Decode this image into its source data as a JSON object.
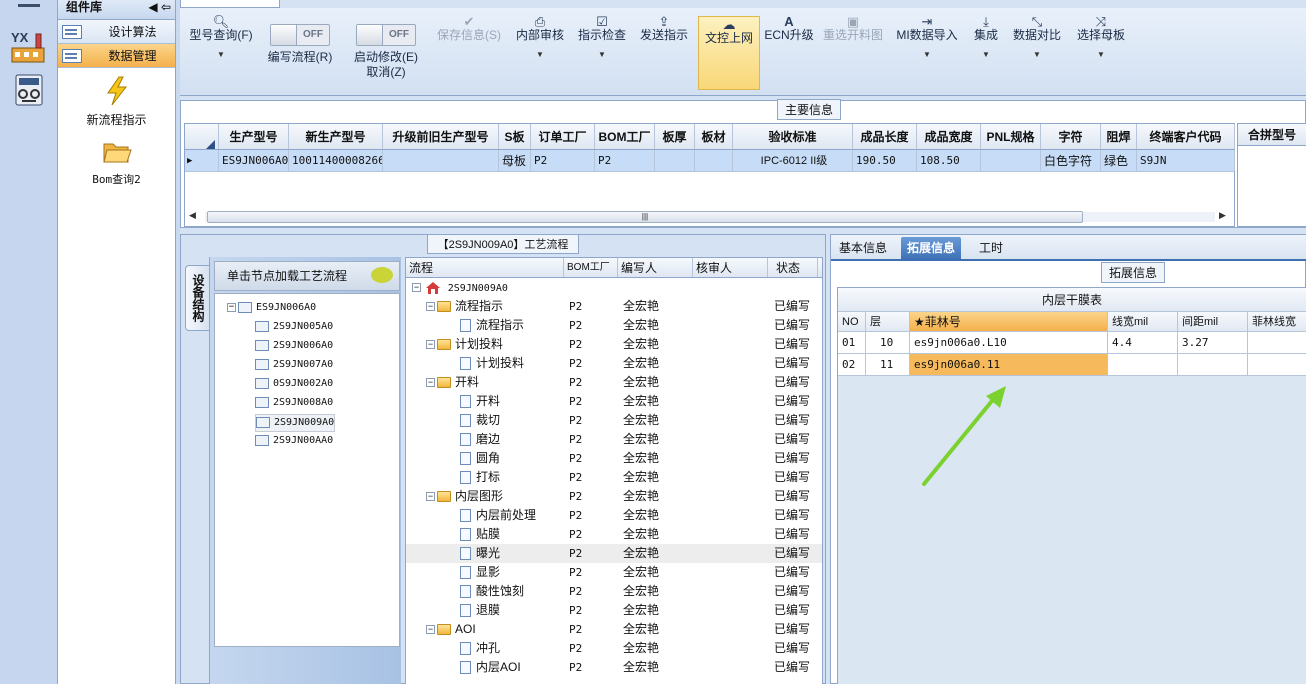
{
  "library": {
    "title": "组件库",
    "categories": [
      {
        "label": "设计算法",
        "active": false
      },
      {
        "label": "数据管理",
        "active": true
      }
    ],
    "tools": [
      {
        "label": "新流程指示",
        "icon": "lightning-icon"
      },
      {
        "label": "Bom查询2",
        "icon": "folder-open-icon"
      }
    ]
  },
  "rail": {
    "app_logo_text": "YX"
  },
  "ribbon": {
    "buttons": [
      {
        "label": "型号查询(F)",
        "icon": "search-icon",
        "dropdown": true
      },
      {
        "label": "编写流程(R)",
        "toggle": "OFF"
      },
      {
        "label": "启动修改(E)",
        "sublabel": "取消(Z)",
        "toggle": "OFF"
      },
      {
        "label": "保存信息(S)",
        "icon": "check-icon",
        "disabled": true
      },
      {
        "label": "内部审核",
        "icon": "print-icon",
        "dropdown": true
      },
      {
        "label": "指示检查",
        "icon": "checkbox-icon",
        "dropdown": true
      },
      {
        "label": "发送指示",
        "icon": "upload-icon"
      },
      {
        "label": "文控上网",
        "icon": "cloud-upload-icon",
        "highlighted": true
      },
      {
        "label": "ECN升级",
        "icon": "font-icon"
      },
      {
        "label": "重选开料图",
        "icon": "image-icon",
        "disabled": true
      },
      {
        "label": "MI数据导入",
        "icon": "sign-in-icon",
        "dropdown": true
      },
      {
        "label": "集成",
        "icon": "download-icon",
        "dropdown": true
      },
      {
        "label": "数据对比",
        "icon": "compress-icon",
        "dropdown": true
      },
      {
        "label": "选择母板",
        "icon": "random-icon",
        "dropdown": true
      }
    ]
  },
  "main_info": {
    "title": "主要信息",
    "columns": [
      "生产型号",
      "新生产型号",
      "升级前旧生产型号",
      "S板",
      "订单工厂",
      "BOM工厂",
      "板厚",
      "板材",
      "验收标准",
      "成品长度",
      "成品宽度",
      "PNL规格",
      "字符",
      "阻焊",
      "终端客户代码"
    ],
    "row": [
      "ES9JN006A0",
      "10011400008266",
      "",
      "母板",
      "P2",
      "P2",
      "",
      "",
      "IPC-6012 II级",
      "190.50",
      "108.50",
      "",
      "白色字符",
      "绿色",
      "S9JN"
    ],
    "side_header": "合拼型号"
  },
  "flow": {
    "title": "【2S9JN009A0】工艺流程",
    "vertical_tab": "设备结构",
    "tree_header": "单击节点加载工艺流程",
    "tree_root": "ES9JN006A0",
    "tree_children": [
      "2S9JN005A0",
      "2S9JN006A0",
      "2S9JN007A0",
      "0S9JN002A0",
      "2S9JN008A0",
      "2S9JN009A0",
      "2S9JN00AA0"
    ],
    "tree_selected_index": 5,
    "grid_headers": [
      "流程",
      "BOM工厂",
      "编写人",
      "核审人",
      "状态"
    ],
    "grid_root": "2S9JN009A0",
    "rows": [
      {
        "name": "流程指示",
        "level": 1,
        "type": "folder",
        "bom": "P2",
        "writer": "全宏艳",
        "status": "已编写"
      },
      {
        "name": "流程指示",
        "level": 2,
        "type": "doc",
        "bom": "P2",
        "writer": "全宏艳",
        "status": "已编写"
      },
      {
        "name": "计划投料",
        "level": 1,
        "type": "folder",
        "bom": "P2",
        "writer": "全宏艳",
        "status": "已编写"
      },
      {
        "name": "计划投料",
        "level": 2,
        "type": "doc",
        "bom": "P2",
        "writer": "全宏艳",
        "status": "已编写"
      },
      {
        "name": "开料",
        "level": 1,
        "type": "folder",
        "bom": "P2",
        "writer": "全宏艳",
        "status": "已编写"
      },
      {
        "name": "开料",
        "level": 2,
        "type": "doc",
        "bom": "P2",
        "writer": "全宏艳",
        "status": "已编写"
      },
      {
        "name": "裁切",
        "level": 2,
        "type": "doc",
        "bom": "P2",
        "writer": "全宏艳",
        "status": "已编写"
      },
      {
        "name": "磨边",
        "level": 2,
        "type": "doc",
        "bom": "P2",
        "writer": "全宏艳",
        "status": "已编写"
      },
      {
        "name": "圆角",
        "level": 2,
        "type": "doc",
        "bom": "P2",
        "writer": "全宏艳",
        "status": "已编写"
      },
      {
        "name": "打标",
        "level": 2,
        "type": "doc",
        "bom": "P2",
        "writer": "全宏艳",
        "status": "已编写"
      },
      {
        "name": "内层图形",
        "level": 1,
        "type": "folder",
        "bom": "P2",
        "writer": "全宏艳",
        "status": "已编写"
      },
      {
        "name": "内层前处理",
        "level": 2,
        "type": "doc",
        "bom": "P2",
        "writer": "全宏艳",
        "status": "已编写"
      },
      {
        "name": "贴膜",
        "level": 2,
        "type": "doc",
        "bom": "P2",
        "writer": "全宏艳",
        "status": "已编写"
      },
      {
        "name": "曝光",
        "level": 2,
        "type": "doc",
        "bom": "P2",
        "writer": "全宏艳",
        "status": "已编写",
        "selected": true
      },
      {
        "name": "显影",
        "level": 2,
        "type": "doc",
        "bom": "P2",
        "writer": "全宏艳",
        "status": "已编写"
      },
      {
        "name": "酸性蚀刻",
        "level": 2,
        "type": "doc",
        "bom": "P2",
        "writer": "全宏艳",
        "status": "已编写"
      },
      {
        "name": "退膜",
        "level": 2,
        "type": "doc",
        "bom": "P2",
        "writer": "全宏艳",
        "status": "已编写"
      },
      {
        "name": "AOI",
        "level": 1,
        "type": "folder",
        "bom": "P2",
        "writer": "全宏艳",
        "status": "已编写"
      },
      {
        "name": "冲孔",
        "level": 2,
        "type": "doc",
        "bom": "P2",
        "writer": "全宏艳",
        "status": "已编写"
      },
      {
        "name": "内层AOI",
        "level": 2,
        "type": "doc",
        "bom": "P2",
        "writer": "全宏艳",
        "status": "已编写"
      }
    ]
  },
  "detail": {
    "tabs": [
      {
        "label": "基本信息",
        "active": false
      },
      {
        "label": "拓展信息",
        "active": true
      },
      {
        "label": "工时",
        "active": false
      }
    ],
    "section_title": "拓展信息",
    "table_caption": "内层干膜表",
    "headers": [
      "NO",
      "层",
      "★菲林号",
      "线宽mil",
      "间距mil",
      "菲林线宽"
    ],
    "rows": [
      [
        "01",
        "10",
        "es9jn006a0.L10",
        "4.4",
        "3.27",
        ""
      ],
      [
        "02",
        "11",
        "es9jn006a0.11",
        "",
        "",
        ""
      ]
    ]
  }
}
